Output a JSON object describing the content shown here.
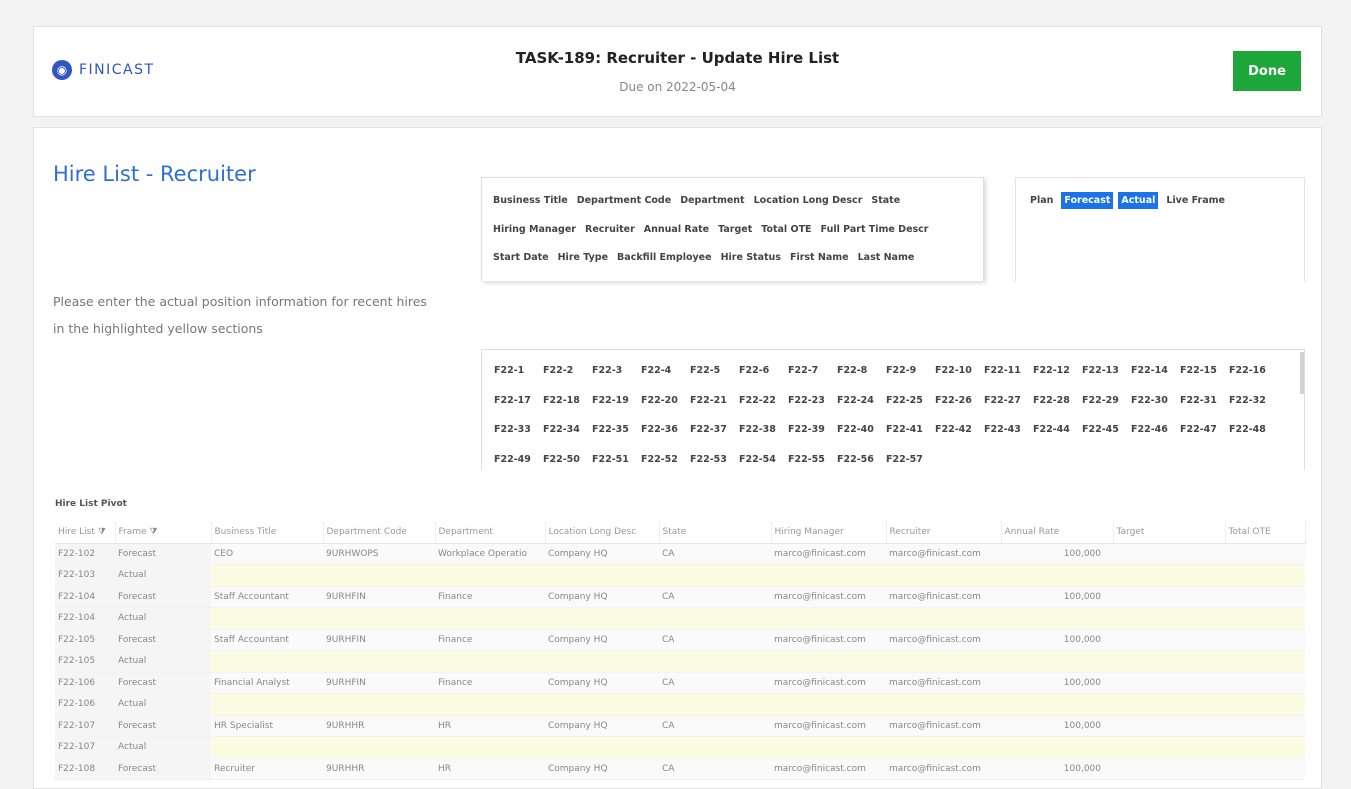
{
  "header": {
    "logo_mark": "◉",
    "logo_text": "FINICAST",
    "task_title": "TASK-189: Recruiter - Update Hire List",
    "due_text": "Due on 2022-05-04",
    "done_label": "Done",
    "done_color": "#1ea83c"
  },
  "main": {
    "heading": "Hire List - Recruiter",
    "instructions": "Please enter the actual position information for recent hires in the highlighted yellow sections"
  },
  "field_chips": [
    "Business Title",
    "Department Code",
    "Department",
    "Location Long Descr",
    "State",
    "Hiring Manager",
    "Recruiter",
    "Annual Rate",
    "Target",
    "Total OTE",
    "Full Part Time Descr",
    "Start Date",
    "Hire Type",
    "Backfill Employee",
    "Hire Status",
    "First Name",
    "Last Name"
  ],
  "frame_chips": [
    {
      "label": "Plan",
      "selected": false
    },
    {
      "label": "Forecast",
      "selected": true
    },
    {
      "label": "Actual",
      "selected": true
    },
    {
      "label": "Live Frame",
      "selected": false
    }
  ],
  "periods": [
    "F22-1",
    "F22-2",
    "F22-3",
    "F22-4",
    "F22-5",
    "F22-6",
    "F22-7",
    "F22-8",
    "F22-9",
    "F22-10",
    "F22-11",
    "F22-12",
    "F22-13",
    "F22-14",
    "F22-15",
    "F22-16",
    "F22-17",
    "F22-18",
    "F22-19",
    "F22-20",
    "F22-21",
    "F22-22",
    "F22-23",
    "F22-24",
    "F22-25",
    "F22-26",
    "F22-27",
    "F22-28",
    "F22-29",
    "F22-30",
    "F22-31",
    "F22-32",
    "F22-33",
    "F22-34",
    "F22-35",
    "F22-36",
    "F22-37",
    "F22-38",
    "F22-39",
    "F22-40",
    "F22-41",
    "F22-42",
    "F22-43",
    "F22-44",
    "F22-45",
    "F22-46",
    "F22-47",
    "F22-48",
    "F22-49",
    "F22-50",
    "F22-51",
    "F22-52",
    "F22-53",
    "F22-54",
    "F22-55",
    "F22-56",
    "F22-57"
  ],
  "pivot": {
    "label": "Hire List Pivot",
    "filter_icon": "⧩",
    "columns": [
      "Hire List",
      "Frame",
      "Business Title",
      "Department Code",
      "Department",
      "Location Long Desc",
      "State",
      "Hiring Manager",
      "Recruiter",
      "Annual Rate",
      "Target",
      "Total OTE"
    ],
    "rows": [
      {
        "kind": "forecast",
        "cells": [
          "F22-102",
          "Forecast",
          "CEO",
          "9URHWOPS",
          "Workplace Operatio",
          "Company HQ",
          "CA",
          "marco@finicast.com",
          "marco@finicast.com",
          "100,000",
          "",
          ""
        ]
      },
      {
        "kind": "actual",
        "cells": [
          "F22-103",
          "Actual",
          "",
          "",
          "",
          "",
          "",
          "",
          "",
          "",
          "",
          ""
        ]
      },
      {
        "kind": "forecast",
        "cells": [
          "F22-104",
          "Forecast",
          "Staff Accountant",
          "9URHFIN",
          "Finance",
          "Company HQ",
          "CA",
          "marco@finicast.com",
          "marco@finicast.com",
          "100,000",
          "",
          ""
        ]
      },
      {
        "kind": "actual",
        "cells": [
          "F22-104",
          "Actual",
          "",
          "",
          "",
          "",
          "",
          "",
          "",
          "",
          "",
          ""
        ]
      },
      {
        "kind": "forecast",
        "cells": [
          "F22-105",
          "Forecast",
          "Staff Accountant",
          "9URHFIN",
          "Finance",
          "Company HQ",
          "CA",
          "marco@finicast.com",
          "marco@finicast.com",
          "100,000",
          "",
          ""
        ]
      },
      {
        "kind": "actual",
        "cells": [
          "F22-105",
          "Actual",
          "",
          "",
          "",
          "",
          "",
          "",
          "",
          "",
          "",
          ""
        ]
      },
      {
        "kind": "forecast",
        "cells": [
          "F22-106",
          "Forecast",
          "Financial Analyst",
          "9URHFIN",
          "Finance",
          "Company HQ",
          "CA",
          "marco@finicast.com",
          "marco@finicast.com",
          "100,000",
          "",
          ""
        ]
      },
      {
        "kind": "actual",
        "cells": [
          "F22-106",
          "Actual",
          "",
          "",
          "",
          "",
          "",
          "",
          "",
          "",
          "",
          ""
        ]
      },
      {
        "kind": "forecast",
        "cells": [
          "F22-107",
          "Forecast",
          "HR Specialist",
          "9URHHR",
          "HR",
          "Company HQ",
          "CA",
          "marco@finicast.com",
          "marco@finicast.com",
          "100,000",
          "",
          ""
        ]
      },
      {
        "kind": "actual",
        "cells": [
          "F22-107",
          "Actual",
          "",
          "",
          "",
          "",
          "",
          "",
          "",
          "",
          "",
          ""
        ]
      },
      {
        "kind": "forecast",
        "cells": [
          "F22-108",
          "Forecast",
          "Recruiter",
          "9URHHR",
          "HR",
          "Company HQ",
          "CA",
          "marco@finicast.com",
          "marco@finicast.com",
          "100,000",
          "",
          ""
        ]
      }
    ]
  }
}
